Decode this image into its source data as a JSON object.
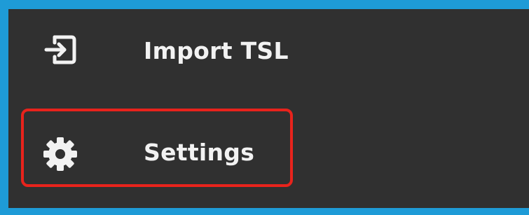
{
  "menu": {
    "items": [
      {
        "label": "Import TSL",
        "icon": "import-icon"
      },
      {
        "label": "Settings",
        "icon": "gear-icon"
      }
    ]
  },
  "colors": {
    "frame_border": "#1e9bd7",
    "menu_background": "#303030",
    "text": "#f2f2f2",
    "highlight": "#e8231c"
  }
}
